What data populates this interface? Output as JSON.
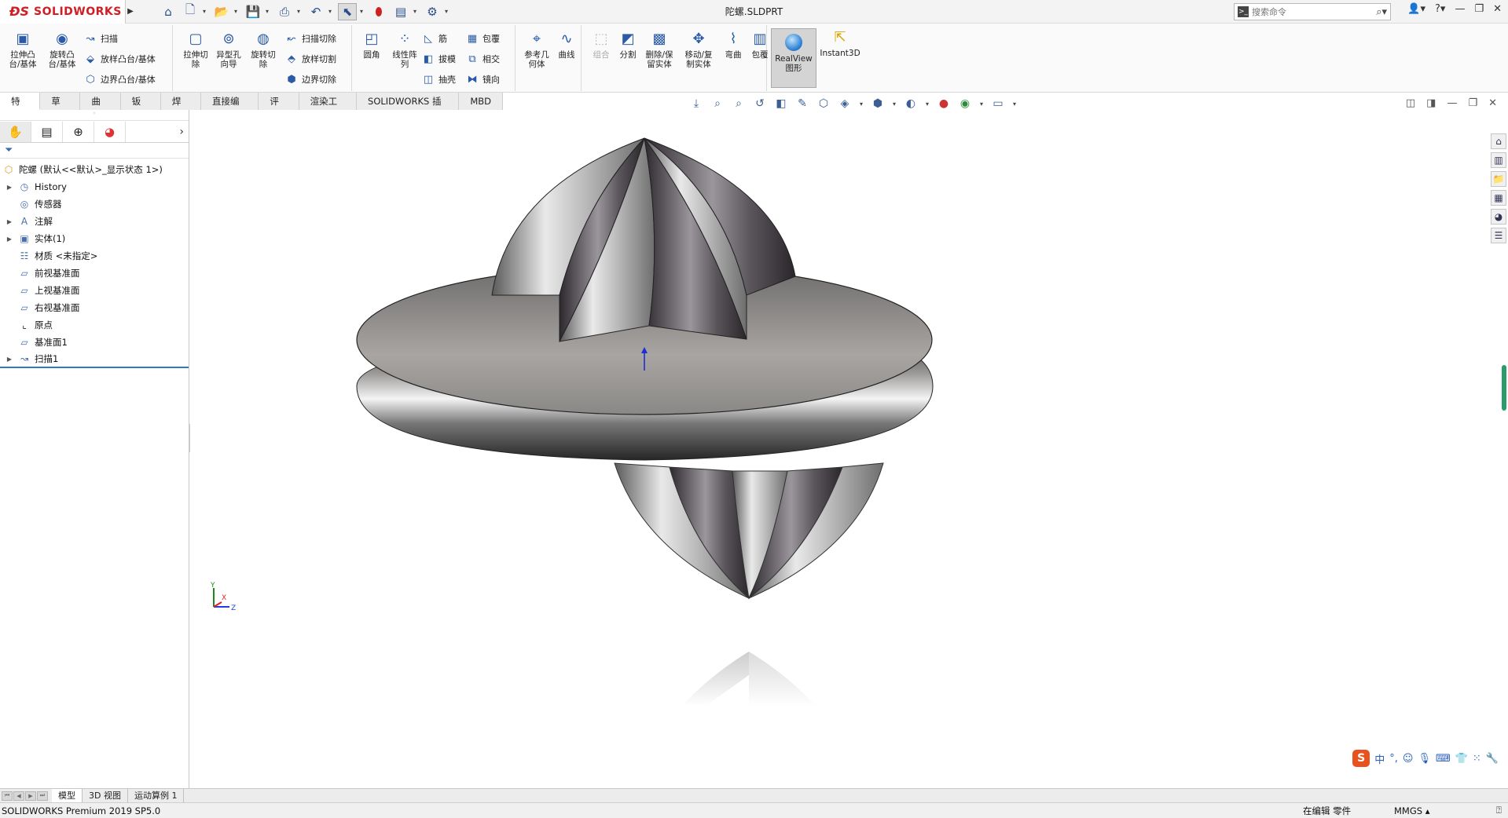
{
  "app": {
    "logo_text": "SOLIDWORKS",
    "document_title": "陀螺.SLDPRT",
    "search_placeholder": "搜索命令"
  },
  "ribbon": {
    "extrude_boss": "拉伸凸\n台/基体",
    "revolve_boss": "旋转凸\n台/基体",
    "sweep": "扫描",
    "loft_boss": "放样凸台/基体",
    "boundary_boss": "边界凸台/基体",
    "extrude_cut": "拉伸切\n除",
    "hole_wizard": "异型孔\n向导",
    "revolve_cut": "旋转切\n除",
    "sweep_cut": "扫描切除",
    "loft_cut": "放样切割",
    "boundary_cut": "边界切除",
    "fillet": "圆角",
    "linear_pattern": "线性阵\n列",
    "rib": "筋",
    "draft": "拔模",
    "shell": "抽壳",
    "wrap": "包覆",
    "intersect": "相交",
    "mirror": "镜向",
    "ref_geometry": "参考几\n何体",
    "curves": "曲线",
    "combine": "组合",
    "split": "分割",
    "delete_keep_body": "删除/保\n留实体",
    "move_copy_body": "移动/复\n制实体",
    "flex": "弯曲",
    "wrap2": "包覆",
    "realview": "RealView\n图形",
    "instant3d": "Instant3D"
  },
  "tabs": [
    "特征",
    "草图",
    "曲面",
    "钣金",
    "焊件",
    "直接编辑",
    "评估",
    "渲染工具",
    "SOLIDWORKS 插件",
    "MBD"
  ],
  "tree": {
    "root": "陀螺 (默认<<默认>_显示状态 1>)",
    "items": [
      {
        "label": "History",
        "expandable": true
      },
      {
        "label": "传感器",
        "expandable": false
      },
      {
        "label": "注解",
        "expandable": true
      },
      {
        "label": "实体(1)",
        "expandable": true
      },
      {
        "label": "材质 <未指定>",
        "expandable": false
      },
      {
        "label": "前视基准面",
        "expandable": false
      },
      {
        "label": "上视基准面",
        "expandable": false
      },
      {
        "label": "右视基准面",
        "expandable": false
      },
      {
        "label": "原点",
        "expandable": false
      },
      {
        "label": "基准面1",
        "expandable": false
      },
      {
        "label": "扫描1",
        "expandable": true
      }
    ]
  },
  "bottom_tabs": [
    "模型",
    "3D 视图",
    "运动算例 1"
  ],
  "status": {
    "product": "SOLIDWORKS Premium 2019 SP5.0",
    "mode": "在编辑 零件",
    "units": "MMGS"
  },
  "triad": {
    "x": "X",
    "y": "Y",
    "z": "Z"
  },
  "ime": {
    "logo": "S",
    "lang": "中"
  },
  "colors": {
    "brand": "#d21d24",
    "accent": "#2b5ba7",
    "selection": "#2c7ac9"
  }
}
